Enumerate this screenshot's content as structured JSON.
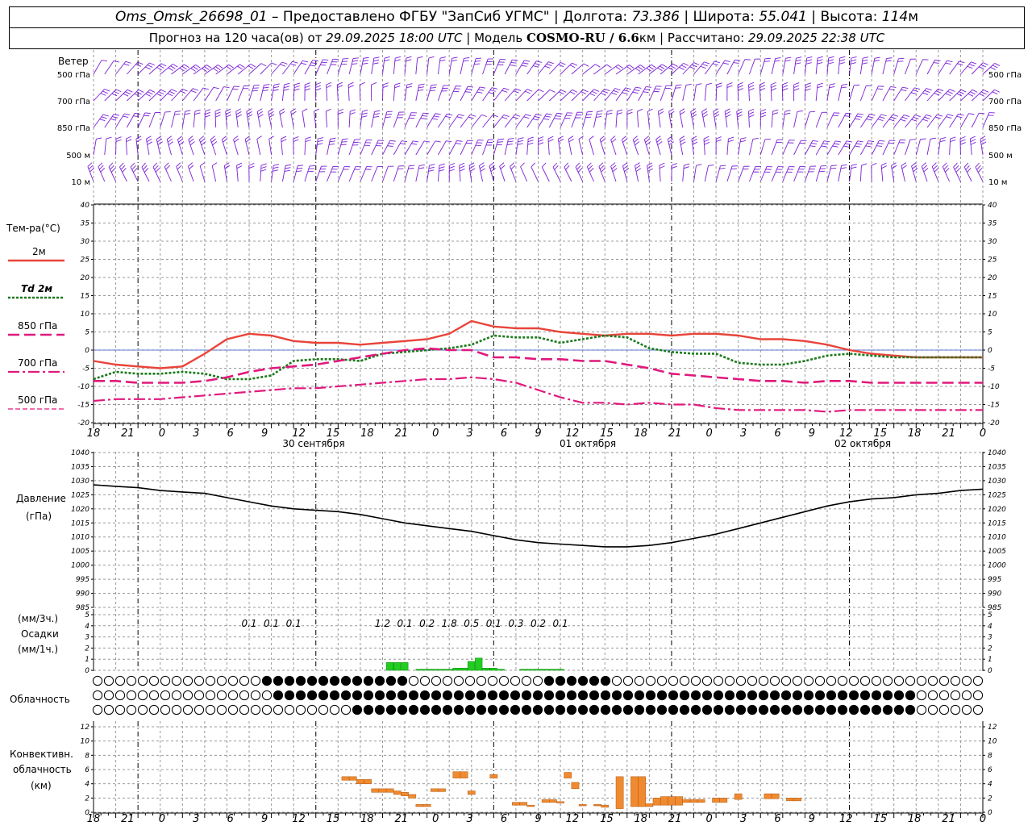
{
  "header": {
    "station": "Oms_Omsk_26698_01",
    "provided_prefix": "– Предоставлено ФГБУ",
    "provider": "\"ЗапСиб УГМС\"",
    "lon_label": "Долгота:",
    "lon": "73.386",
    "lat_label": "Широта:",
    "lat": "55.041",
    "alt_label": "Высота:",
    "alt": "114",
    "alt_unit": "м",
    "forecast_prefix": "Прогноз на 120 часа(ов) от",
    "forecast_start": "29.09.2025 18:00 UTC",
    "model_label": "Модель",
    "model": "COSMO-RU / 6.6",
    "model_unit": "км",
    "calc_label": "Рассчитано:",
    "calc_time": "29.09.2025 22:38 UTC"
  },
  "colors": {
    "wind": "#7a1fd6",
    "t2m": "#e8443a",
    "td2m": "#1b7a1b",
    "t850": "#e0197d",
    "t700": "#e0197d",
    "t500": "#e0197d",
    "pressure": "#000000",
    "precip": "#22cc22",
    "convective": "#f08a30",
    "grid": "#999999"
  },
  "wind_panel": {
    "title": "Ветер",
    "levels": [
      "500 гПа",
      "700 гПа",
      "850 гПа",
      "500 м",
      "10 м"
    ]
  },
  "temp_panel": {
    "title": "Тем-ра(°C)",
    "legend": [
      "2м",
      "Td 2м",
      "850 гПа",
      "700 гПа",
      "500 гПа"
    ]
  },
  "pressure_panel": {
    "title_line1": "Давление",
    "title_line2": "(гПа)"
  },
  "precip_panel": {
    "unit3h": "(мм/3ч.)",
    "title": "Осадки",
    "unit1h": "(мм/1ч.)"
  },
  "cloud_panel": {
    "title": "Облачность"
  },
  "conv_panel": {
    "title_line1": "Конвективн.",
    "title_line2": "облачность",
    "title_line3": "(км)"
  },
  "x_axis": {
    "hour_labels": [
      "18",
      "21",
      "0",
      "3",
      "6",
      "9",
      "12",
      "15",
      "18",
      "21",
      "0",
      "3",
      "6",
      "9",
      "12",
      "15",
      "18",
      "21",
      "0",
      "3",
      "6",
      "9",
      "12",
      "15",
      "18",
      "21",
      "0"
    ],
    "dates": [
      "30 сентября",
      "01 октября",
      "02 октября"
    ]
  },
  "chart_data": [
    {
      "type": "line",
      "title": "Тем-ра(°C)",
      "x_hours": [
        0,
        3,
        6,
        9,
        12,
        15,
        18,
        21,
        24,
        27,
        30,
        33,
        36,
        39,
        42,
        45,
        48,
        51,
        54,
        57,
        60,
        63,
        66,
        69,
        72,
        75,
        78,
        81,
        84,
        87,
        90,
        93,
        96,
        99,
        102,
        105,
        108,
        111,
        114,
        117,
        120
      ],
      "ylim": [
        -20,
        40
      ],
      "series": [
        {
          "name": "2м",
          "values": [
            -3,
            -4,
            -4.5,
            -5,
            -4.5,
            -1,
            3,
            4.5,
            4,
            2.5,
            2,
            2,
            1.5,
            2,
            2.5,
            3,
            4.5,
            8,
            6.5,
            6,
            6,
            5,
            4.5,
            4,
            4.5,
            4.5,
            4,
            4.5,
            4.5,
            4,
            3,
            3,
            2.5,
            1.5,
            0,
            -1,
            -1.5,
            -2,
            -2,
            -2,
            -2
          ]
        },
        {
          "name": "Td 2м",
          "values": [
            -8,
            -6,
            -6.5,
            -6.5,
            -6,
            -6.5,
            -8,
            -8,
            -7,
            -3,
            -2.5,
            -2.5,
            -3,
            -1,
            -0.5,
            0,
            0.5,
            1.5,
            4,
            3.5,
            3.5,
            2,
            3,
            4,
            3.5,
            0.5,
            -0.5,
            -1,
            -1,
            -3.5,
            -4,
            -4,
            -3,
            -1.5,
            -1,
            -1.5,
            -2,
            -2,
            -2,
            -2,
            -2
          ]
        },
        {
          "name": "850 гПа",
          "values": [
            -8.5,
            -8.5,
            -9,
            -9,
            -9,
            -8.5,
            -7.5,
            -6,
            -5,
            -4.5,
            -4,
            -3,
            -2,
            -1,
            0,
            0.5,
            0,
            0,
            -2,
            -2,
            -2.5,
            -2.5,
            -3,
            -3,
            -4,
            -5,
            -6.5,
            -7,
            -7.5,
            -8,
            -8.5,
            -8.5,
            -9,
            -8.5,
            -8.5,
            -9,
            -9,
            -9,
            -9,
            -9,
            -9
          ]
        },
        {
          "name": "700 гПа",
          "values": [
            -14,
            -13.5,
            -13.5,
            -13.5,
            -13,
            -12.5,
            -12,
            -11.5,
            -11,
            -10.5,
            -10.5,
            -10,
            -9.5,
            -9,
            -8.5,
            -8,
            -8,
            -7.5,
            -8,
            -9,
            -11,
            -13,
            -14.5,
            -14.5,
            -15,
            -14.5,
            -15,
            -15,
            -16,
            -16.5,
            -16.5,
            -16.5,
            -16.5,
            -17,
            -16.5,
            -16.5,
            -16.5,
            -16.5,
            -16.5,
            -16.5,
            -16.5
          ]
        }
      ]
    },
    {
      "type": "line",
      "title": "Давление (гПа)",
      "x_hours": [
        0,
        3,
        6,
        9,
        12,
        15,
        18,
        21,
        24,
        27,
        30,
        33,
        36,
        39,
        42,
        45,
        48,
        51,
        54,
        57,
        60,
        63,
        66,
        69,
        72,
        75,
        78,
        81,
        84,
        87,
        90,
        93,
        96,
        99,
        102,
        105,
        108,
        111,
        114,
        117,
        120
      ],
      "ylim": [
        985,
        1040
      ],
      "series": [
        {
          "name": "Давление",
          "values": [
            1028.5,
            1028,
            1027.5,
            1026.5,
            1026,
            1025.5,
            1024,
            1022.5,
            1021,
            1020,
            1019.5,
            1019,
            1018,
            1016.5,
            1015,
            1014,
            1013,
            1012,
            1010.5,
            1009,
            1008,
            1007.5,
            1007,
            1006.5,
            1006.5,
            1007,
            1008,
            1009.5,
            1011,
            1013,
            1015,
            1017,
            1019,
            1021,
            1022.5,
            1023.5,
            1024,
            1025,
            1025.5,
            1026.5,
            1027
          ]
        }
      ]
    },
    {
      "type": "bar",
      "title": "Осадки",
      "ylim": [
        0,
        5
      ],
      "labels_3h": [
        {
          "hour": 21,
          "value": "0.1"
        },
        {
          "hour": 24,
          "value": "0.1"
        },
        {
          "hour": 27,
          "value": "0.1"
        },
        {
          "hour": 39,
          "value": "1.2"
        },
        {
          "hour": 42,
          "value": "0.1"
        },
        {
          "hour": 45,
          "value": "0.2"
        },
        {
          "hour": 48,
          "value": "1.8"
        },
        {
          "hour": 51,
          "value": "0.5"
        },
        {
          "hour": 54,
          "value": "0.1"
        },
        {
          "hour": 57,
          "value": "0.3"
        },
        {
          "hour": 60,
          "value": "0.2"
        },
        {
          "hour": 63,
          "value": "0.1"
        }
      ],
      "hourly": [
        {
          "hour": 40,
          "value": 0.7
        },
        {
          "hour": 41,
          "value": 0.7
        },
        {
          "hour": 42,
          "value": 0.7
        },
        {
          "hour": 44,
          "value": 0.1
        },
        {
          "hour": 45,
          "value": 0.1
        },
        {
          "hour": 46,
          "value": 0.1
        },
        {
          "hour": 47,
          "value": 0.1
        },
        {
          "hour": 48,
          "value": 0.1
        },
        {
          "hour": 49,
          "value": 0.2
        },
        {
          "hour": 50,
          "value": 0.2
        },
        {
          "hour": 51,
          "value": 0.8
        },
        {
          "hour": 52,
          "value": 1.1
        },
        {
          "hour": 53,
          "value": 0.2
        },
        {
          "hour": 54,
          "value": 0.2
        },
        {
          "hour": 55,
          "value": 0.1
        },
        {
          "hour": 58,
          "value": 0.1
        },
        {
          "hour": 59,
          "value": 0.1
        },
        {
          "hour": 60,
          "value": 0.1
        },
        {
          "hour": 61,
          "value": 0.1
        },
        {
          "hour": 62,
          "value": 0.1
        },
        {
          "hour": 63,
          "value": 0.1
        }
      ]
    },
    {
      "type": "bar",
      "title": "Конвективн. облачность (км)",
      "ylim": [
        0,
        13
      ],
      "bars": [
        {
          "hour": 34,
          "base": 4.5,
          "top": 5.0
        },
        {
          "hour": 35,
          "base": 4.5,
          "top": 5.0
        },
        {
          "hour": 36,
          "base": 4.0,
          "top": 4.6
        },
        {
          "hour": 37,
          "base": 4.0,
          "top": 4.6
        },
        {
          "hour": 38,
          "base": 2.8,
          "top": 3.3
        },
        {
          "hour": 39,
          "base": 2.8,
          "top": 3.3
        },
        {
          "hour": 40,
          "base": 2.8,
          "top": 3.3
        },
        {
          "hour": 41,
          "base": 2.5,
          "top": 3.0
        },
        {
          "hour": 42,
          "base": 2.3,
          "top": 2.8
        },
        {
          "hour": 43,
          "base": 2.0,
          "top": 2.5
        },
        {
          "hour": 44,
          "base": 0.8,
          "top": 1.1
        },
        {
          "hour": 45,
          "base": 0.8,
          "top": 1.1
        },
        {
          "hour": 46,
          "base": 2.9,
          "top": 3.3
        },
        {
          "hour": 47,
          "base": 2.9,
          "top": 3.3
        },
        {
          "hour": 49,
          "base": 4.8,
          "top": 5.7
        },
        {
          "hour": 50,
          "base": 4.8,
          "top": 5.7
        },
        {
          "hour": 51,
          "base": 2.5,
          "top": 3.0
        },
        {
          "hour": 54,
          "base": 4.8,
          "top": 5.3
        },
        {
          "hour": 57,
          "base": 1.0,
          "top": 1.4
        },
        {
          "hour": 58,
          "base": 1.0,
          "top": 1.4
        },
        {
          "hour": 59,
          "base": 0.8,
          "top": 1.0
        },
        {
          "hour": 61,
          "base": 1.4,
          "top": 1.8
        },
        {
          "hour": 62,
          "base": 1.4,
          "top": 1.8
        },
        {
          "hour": 63,
          "base": 1.3,
          "top": 1.5
        },
        {
          "hour": 64,
          "base": 4.8,
          "top": 5.6
        },
        {
          "hour": 65,
          "base": 3.3,
          "top": 4.2
        },
        {
          "hour": 66,
          "base": 0.9,
          "top": 1.1
        },
        {
          "hour": 68,
          "base": 0.9,
          "top": 1.1
        },
        {
          "hour": 69,
          "base": 0.7,
          "top": 1.0
        },
        {
          "hour": 71,
          "base": 0.5,
          "top": 5.0
        },
        {
          "hour": 73,
          "base": 0.8,
          "top": 5.0
        },
        {
          "hour": 74,
          "base": 0.8,
          "top": 5.0
        },
        {
          "hour": 75,
          "base": 0.8,
          "top": 1.2
        },
        {
          "hour": 76,
          "base": 1.0,
          "top": 2.0
        },
        {
          "hour": 77,
          "base": 1.0,
          "top": 2.2
        },
        {
          "hour": 78,
          "base": 1.0,
          "top": 2.2
        },
        {
          "hour": 79,
          "base": 1.0,
          "top": 2.2
        },
        {
          "hour": 80,
          "base": 1.4,
          "top": 1.8
        },
        {
          "hour": 81,
          "base": 1.4,
          "top": 1.8
        },
        {
          "hour": 82,
          "base": 1.4,
          "top": 1.8
        },
        {
          "hour": 84,
          "base": 1.4,
          "top": 2.0
        },
        {
          "hour": 85,
          "base": 1.4,
          "top": 2.0
        },
        {
          "hour": 87,
          "base": 1.8,
          "top": 2.6
        },
        {
          "hour": 91,
          "base": 1.9,
          "top": 2.6
        },
        {
          "hour": 92,
          "base": 1.9,
          "top": 2.6
        },
        {
          "hour": 94,
          "base": 1.6,
          "top": 2.0
        },
        {
          "hour": 95,
          "base": 1.6,
          "top": 2.0
        }
      ]
    }
  ]
}
